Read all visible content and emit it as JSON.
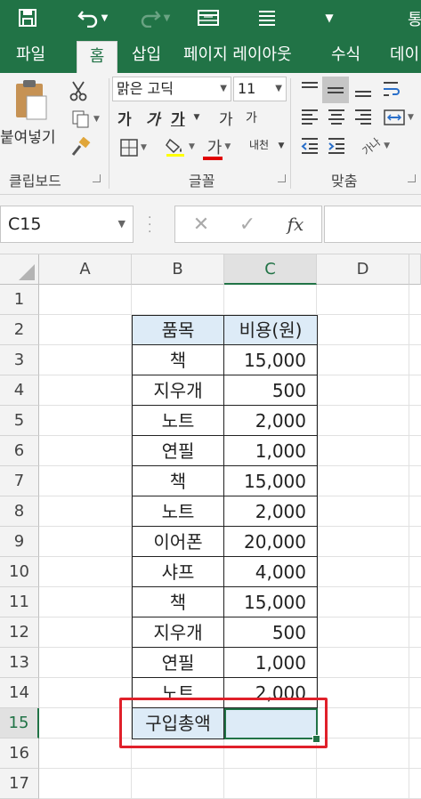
{
  "quick_access": {
    "save_icon": "save-icon",
    "undo_icon": "undo-icon",
    "redo_icon": "redo-icon",
    "title_tail": "통"
  },
  "tabs": [
    "파일",
    "홈",
    "삽입",
    "페이지 레이아웃",
    "수식",
    "데이"
  ],
  "active_tab": "홈",
  "ribbon": {
    "clipboard": {
      "paste_label": "붙여넣기",
      "group_label": "클립보드"
    },
    "font": {
      "font_name": "맑은 고딕",
      "font_size": "11",
      "bold": "가",
      "italic": "가",
      "underline": "가",
      "grow": "가",
      "shrink": "가",
      "font_color": "가",
      "font_color_value": "#e00000",
      "phonetic": "내천",
      "group_label": "글꼴"
    },
    "alignment": {
      "orientation": "가나",
      "group_label": "맞춤"
    }
  },
  "formula_bar": {
    "name_box": "C15",
    "cancel_symbol": "✕",
    "enter_symbol": "✓",
    "fx_label": "fx",
    "formula": ""
  },
  "sheet": {
    "columns": [
      "A",
      "B",
      "C",
      "D"
    ],
    "rows": [
      "1",
      "2",
      "3",
      "4",
      "5",
      "6",
      "7",
      "8",
      "9",
      "10",
      "11",
      "12",
      "13",
      "14",
      "15",
      "16",
      "17"
    ],
    "selected_cell": "C15",
    "table": {
      "header": {
        "item": "품목",
        "cost": "비용(원)"
      },
      "rows": [
        {
          "item": "책",
          "cost": "15,000"
        },
        {
          "item": "지우개",
          "cost": "500"
        },
        {
          "item": "노트",
          "cost": "2,000"
        },
        {
          "item": "연필",
          "cost": "1,000"
        },
        {
          "item": "책",
          "cost": "15,000"
        },
        {
          "item": "노트",
          "cost": "2,000"
        },
        {
          "item": "이어폰",
          "cost": "20,000"
        },
        {
          "item": "샤프",
          "cost": "4,000"
        },
        {
          "item": "책",
          "cost": "15,000"
        },
        {
          "item": "지우개",
          "cost": "500"
        },
        {
          "item": "연필",
          "cost": "1,000"
        },
        {
          "item": "노트",
          "cost": "2,000"
        }
      ],
      "total": {
        "label": "구입총액",
        "value": ""
      }
    }
  },
  "colors": {
    "excel_green": "#217346",
    "header_fill": "#ddebf7",
    "highlight_red": "#e0202a"
  }
}
